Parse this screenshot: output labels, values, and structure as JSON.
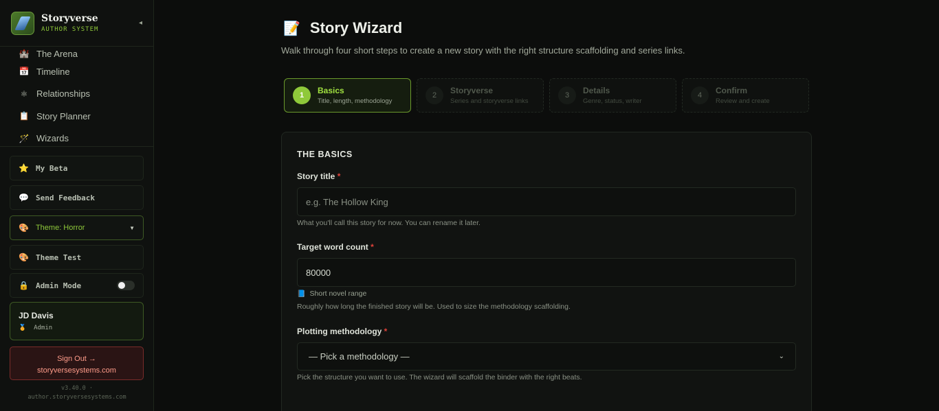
{
  "brand": {
    "name": "Storyverse",
    "subtitle": "AUTHOR SYSTEM",
    "collapse_glyph": "◂"
  },
  "nav": [
    {
      "icon": "🏰",
      "icon_name": "castle-icon",
      "label": "The Arena"
    },
    {
      "icon": "📅",
      "icon_name": "calendar-icon",
      "label": "Timeline"
    },
    {
      "icon": "⚛",
      "icon_name": "network-icon",
      "label": "Relationships"
    },
    {
      "icon": "📋",
      "icon_name": "clipboard-icon",
      "label": "Story Planner"
    },
    {
      "icon": "🪄",
      "icon_name": "wand-icon",
      "label": "Wizards"
    }
  ],
  "sidebar_buttons": {
    "beta": {
      "icon": "⭐",
      "label": "My Beta"
    },
    "feedback": {
      "icon": "💬",
      "label": "Send Feedback"
    },
    "theme": {
      "icon": "🎨",
      "label": "Theme: Horror",
      "caret": "▼"
    },
    "theme_test": {
      "icon": "🎨",
      "label": "Theme Test"
    },
    "admin": {
      "icon": "🔒",
      "label": "Admin Mode",
      "enabled": false
    }
  },
  "user": {
    "name": "JD Davis",
    "role_icon": "🏅",
    "role": "Admin"
  },
  "signout": {
    "line1": "Sign Out →",
    "line2": "storyversesystems.com"
  },
  "version": {
    "line1": "v3.40.0 ·",
    "line2": "author.storyversesystems.com"
  },
  "page": {
    "icon": "📝",
    "title": "Story Wizard",
    "subtitle": "Walk through four short steps to create a new story with the right structure scaffolding and series links."
  },
  "steps": [
    {
      "num": "1",
      "title": "Basics",
      "desc": "Title, length, methodology",
      "active": true
    },
    {
      "num": "2",
      "title": "Storyverse",
      "desc": "Series and storyverse links",
      "active": false
    },
    {
      "num": "3",
      "title": "Details",
      "desc": "Genre, status, writer",
      "active": false
    },
    {
      "num": "4",
      "title": "Confirm",
      "desc": "Review and create",
      "active": false
    }
  ],
  "form": {
    "section_title": "THE BASICS",
    "title_field": {
      "label": "Story title",
      "required": "*",
      "placeholder": "e.g. The Hollow King",
      "value": "",
      "hint": "What you'll call this story for now. You can rename it later."
    },
    "word_count_field": {
      "label": "Target word count",
      "required": "*",
      "value": "80000",
      "range_icon": "📘",
      "range_label": "Short novel range",
      "hint": "Roughly how long the finished story will be. Used to size the methodology scaffolding."
    },
    "methodology_field": {
      "label": "Plotting methodology",
      "required": "*",
      "selected": "— Pick a methodology —",
      "chevron": "⌄",
      "hint": "Pick the structure you want to use. The wizard will scaffold the binder with the right beats."
    }
  },
  "colors": {
    "accent": "#8fc93a",
    "danger": "#e0423a",
    "background": "#0c0d0c"
  }
}
